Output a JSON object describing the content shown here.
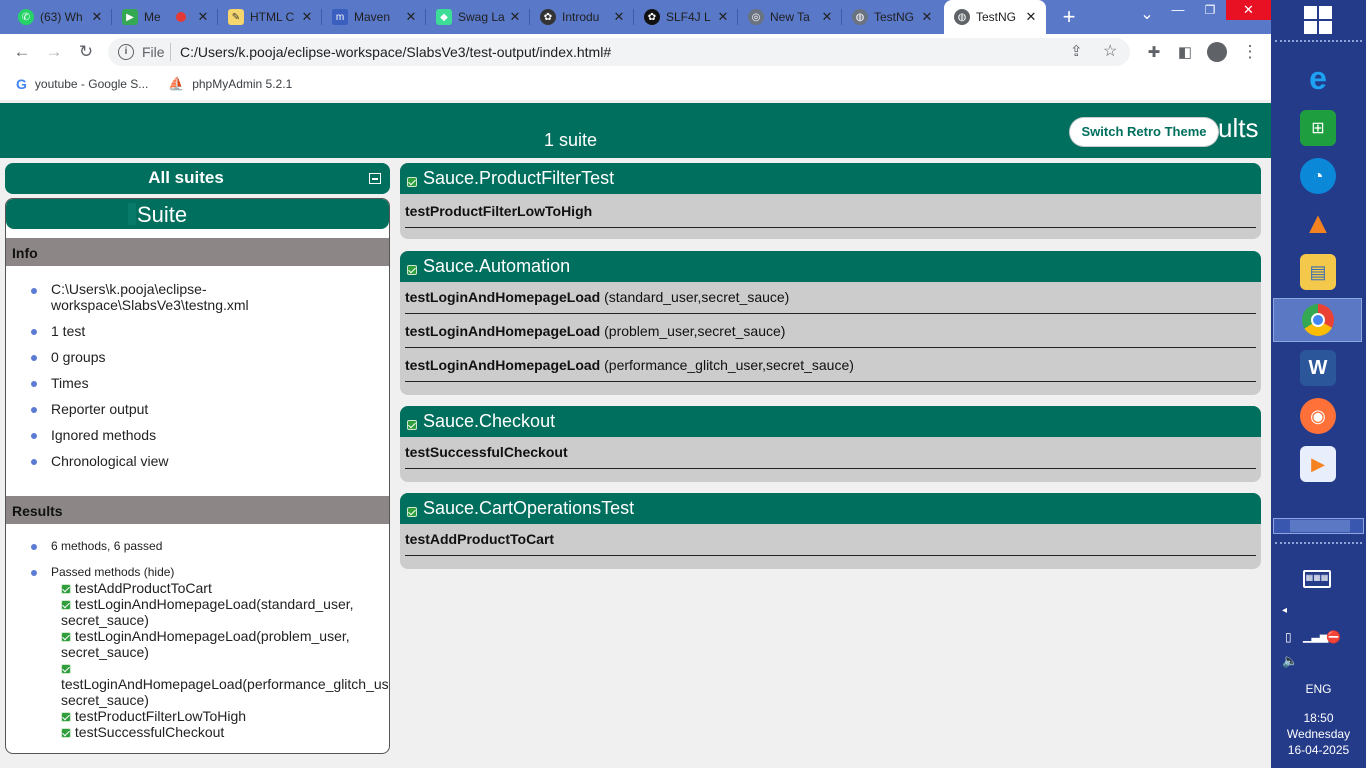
{
  "browser": {
    "tabs": [
      {
        "title": "(63) Wh",
        "icon": "whatsapp-icon",
        "color": "#25d366",
        "glyph": "✆"
      },
      {
        "title": "Me",
        "icon": "meet-icon",
        "color": "#34a853",
        "glyph": "▶"
      },
      {
        "title": "HTML C",
        "icon": "notepad-icon",
        "color": "#f5d76e",
        "glyph": "✎"
      },
      {
        "title": "Maven",
        "icon": "maven-icon",
        "color": "#3b5fbf",
        "glyph": "m"
      },
      {
        "title": "Swag La",
        "icon": "swaglabs-icon",
        "color": "#3ddc97",
        "glyph": "◆"
      },
      {
        "title": "Introdu",
        "icon": "openai-icon",
        "color": "#333333",
        "glyph": "✿"
      },
      {
        "title": "SLF4J L",
        "icon": "chatgpt-icon",
        "color": "#111111",
        "glyph": "✿"
      },
      {
        "title": "New Ta",
        "icon": "chrome-icon",
        "color": "#6b7280",
        "glyph": "◎"
      },
      {
        "title": "TestNG",
        "icon": "globe-icon",
        "color": "#6b7280",
        "glyph": "◍"
      },
      {
        "title": "TestNG",
        "icon": "globe-icon",
        "color": "#5f6368",
        "glyph": "◍",
        "active": true
      }
    ],
    "new_tab": "+",
    "tab_search": "⌄",
    "window_controls": {
      "minimize": "—",
      "restore": "❐",
      "close": "✕"
    },
    "address": {
      "scheme_label": "File",
      "url": "C:/Users/k.pooja/eclipse-workspace/SlabsVe3/test-output/index.html#"
    },
    "bookmarks": [
      {
        "label": "youtube - Google S...",
        "icon": "google-icon"
      },
      {
        "label": "phpMyAdmin 5.2.1",
        "icon": "phpmyadmin-icon"
      }
    ]
  },
  "report": {
    "banner_suite_count": "1 suite",
    "banner_title_fragment": "sults",
    "switch_theme_label": "Switch Retro Theme",
    "all_suites_label": "All suites",
    "suite_label": "Suite",
    "info_header": "Info",
    "info_items": [
      "C:\\Users\\k.pooja\\eclipse-workspace\\SlabsVe3\\testng.xml",
      "1 test",
      "0 groups",
      "Times",
      "Reporter output",
      "Ignored methods",
      "Chronological view"
    ],
    "info_path_line1": "C:\\Users\\k.pooja\\eclipse-",
    "info_path_line2": "workspace\\SlabsVe3\\testng.xml",
    "results_header": "Results",
    "results_summary": "6 methods, 6 passed",
    "passed_methods_label": "Passed methods",
    "hide_label": "(hide)",
    "passed_methods": [
      "testAddProductToCart",
      "testLoginAndHomepageLoad(standard_user, secret_sauce)",
      "testLoginAndHomepageLoad(problem_user, secret_sauce)",
      "testLoginAndHomepageLoad(performance_glitch_user, secret_sauce)",
      "testProductFilterLowToHigh",
      "testSuccessfulCheckout"
    ],
    "classes": [
      {
        "name": "Sauce.ProductFilterTest",
        "methods": [
          {
            "name": "testProductFilterLowToHigh",
            "params": ""
          }
        ]
      },
      {
        "name": "Sauce.Automation",
        "methods": [
          {
            "name": "testLoginAndHomepageLoad",
            "params": "(standard_user,secret_sauce)"
          },
          {
            "name": "testLoginAndHomepageLoad",
            "params": "(problem_user,secret_sauce)"
          },
          {
            "name": "testLoginAndHomepageLoad",
            "params": "(performance_glitch_user,secret_sauce)"
          }
        ]
      },
      {
        "name": "Sauce.Checkout",
        "methods": [
          {
            "name": "testSuccessfulCheckout",
            "params": ""
          }
        ]
      },
      {
        "name": "Sauce.CartOperationsTest",
        "methods": [
          {
            "name": "testAddProductToCart",
            "params": ""
          }
        ]
      }
    ]
  },
  "taskbar": {
    "language": "ENG",
    "time": "18:50",
    "day": "Wednesday",
    "date": "16-04-2025"
  },
  "colors": {
    "teal": "#006f5e",
    "gray_header": "#8c8786",
    "method_bg": "#cccccc"
  }
}
